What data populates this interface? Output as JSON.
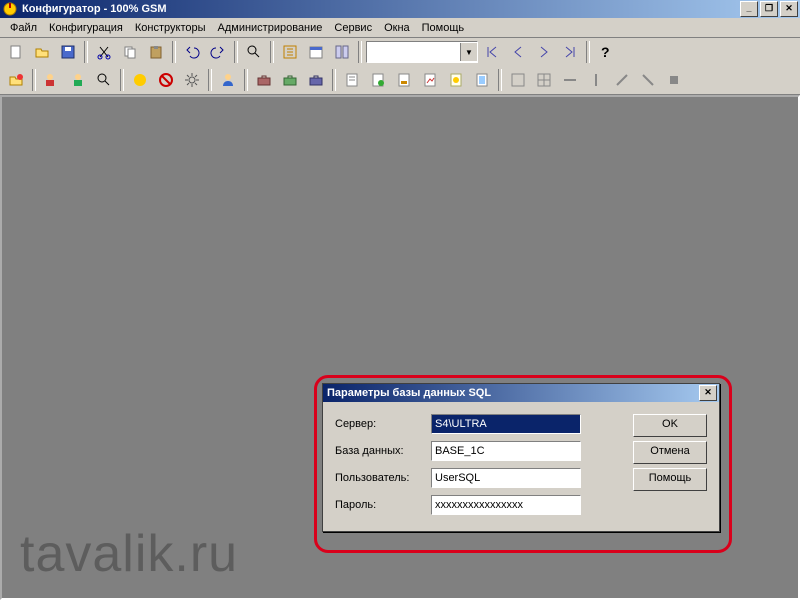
{
  "title": "Конфигуратор - 100% GSM",
  "menu": [
    "Файл",
    "Конфигурация",
    "Конструкторы",
    "Администрирование",
    "Сервис",
    "Окна",
    "Помощь"
  ],
  "watermark": "tavalik.ru",
  "dialog": {
    "title": "Параметры базы данных SQL",
    "labels": {
      "server": "Сервер:",
      "database": "База данных:",
      "user": "Пользователь:",
      "password": "Пароль:"
    },
    "values": {
      "server": "S4\\ULTRA",
      "database": "BASE_1C",
      "user": "UserSQL",
      "password": "xxxxxxxxxxxxxxxx"
    },
    "buttons": {
      "ok": "OK",
      "cancel": "Отмена",
      "help": "Помощь"
    }
  }
}
